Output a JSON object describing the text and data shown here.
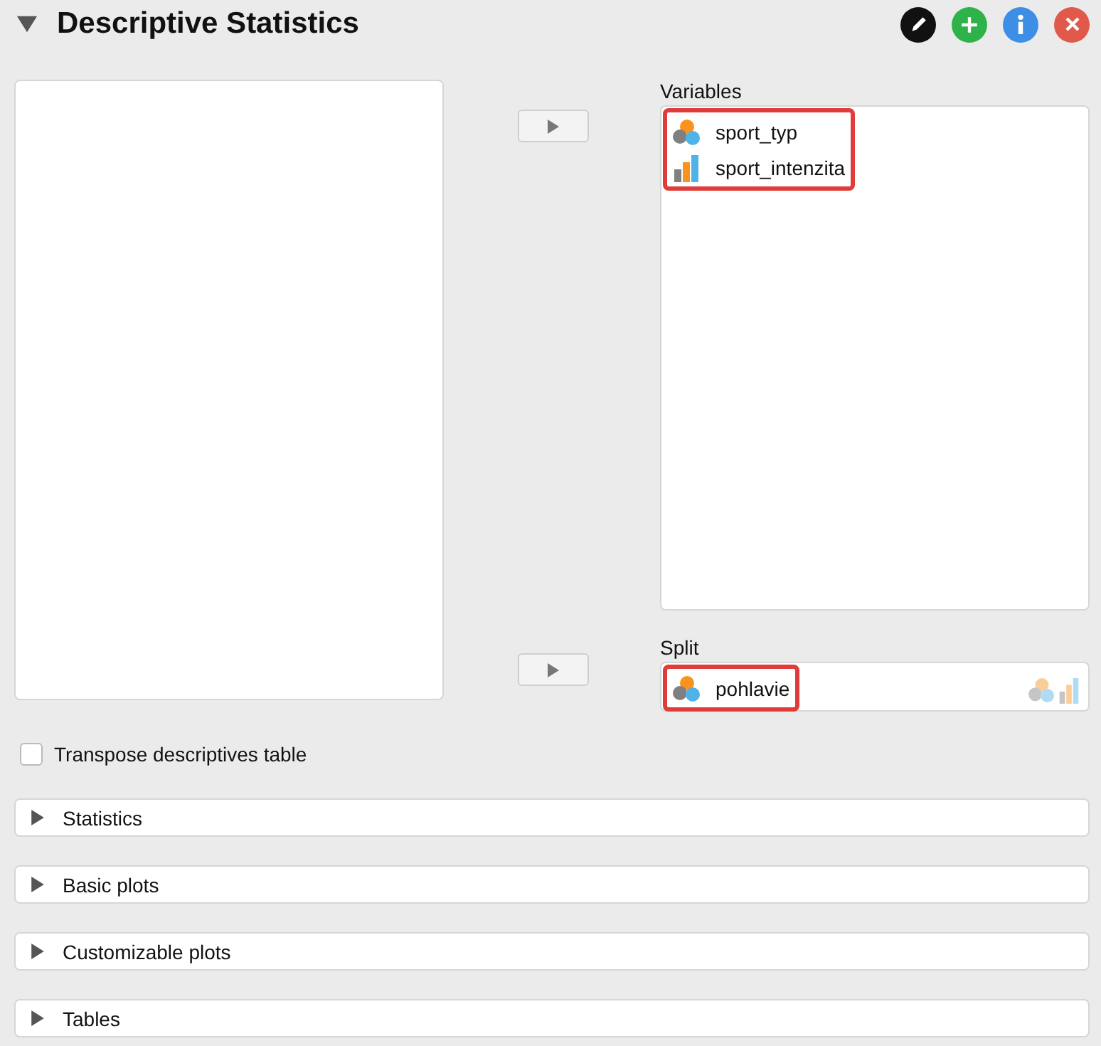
{
  "header": {
    "title": "Descriptive Statistics",
    "expanded": true
  },
  "variables": {
    "label": "Variables",
    "highlighted": true,
    "items": [
      {
        "name": "sport_typ",
        "kind": "nominal"
      },
      {
        "name": "sport_intenzita",
        "kind": "ordinal"
      }
    ]
  },
  "split": {
    "label": "Split",
    "highlighted": true,
    "items": [
      {
        "name": "pohlavie",
        "kind": "nominal"
      }
    ]
  },
  "transpose": {
    "label": "Transpose descriptives table",
    "checked": false
  },
  "sections": [
    {
      "label": "Statistics",
      "expanded": false
    },
    {
      "label": "Basic plots",
      "expanded": false
    },
    {
      "label": "Customizable plots",
      "expanded": false
    },
    {
      "label": "Tables",
      "expanded": false
    }
  ]
}
